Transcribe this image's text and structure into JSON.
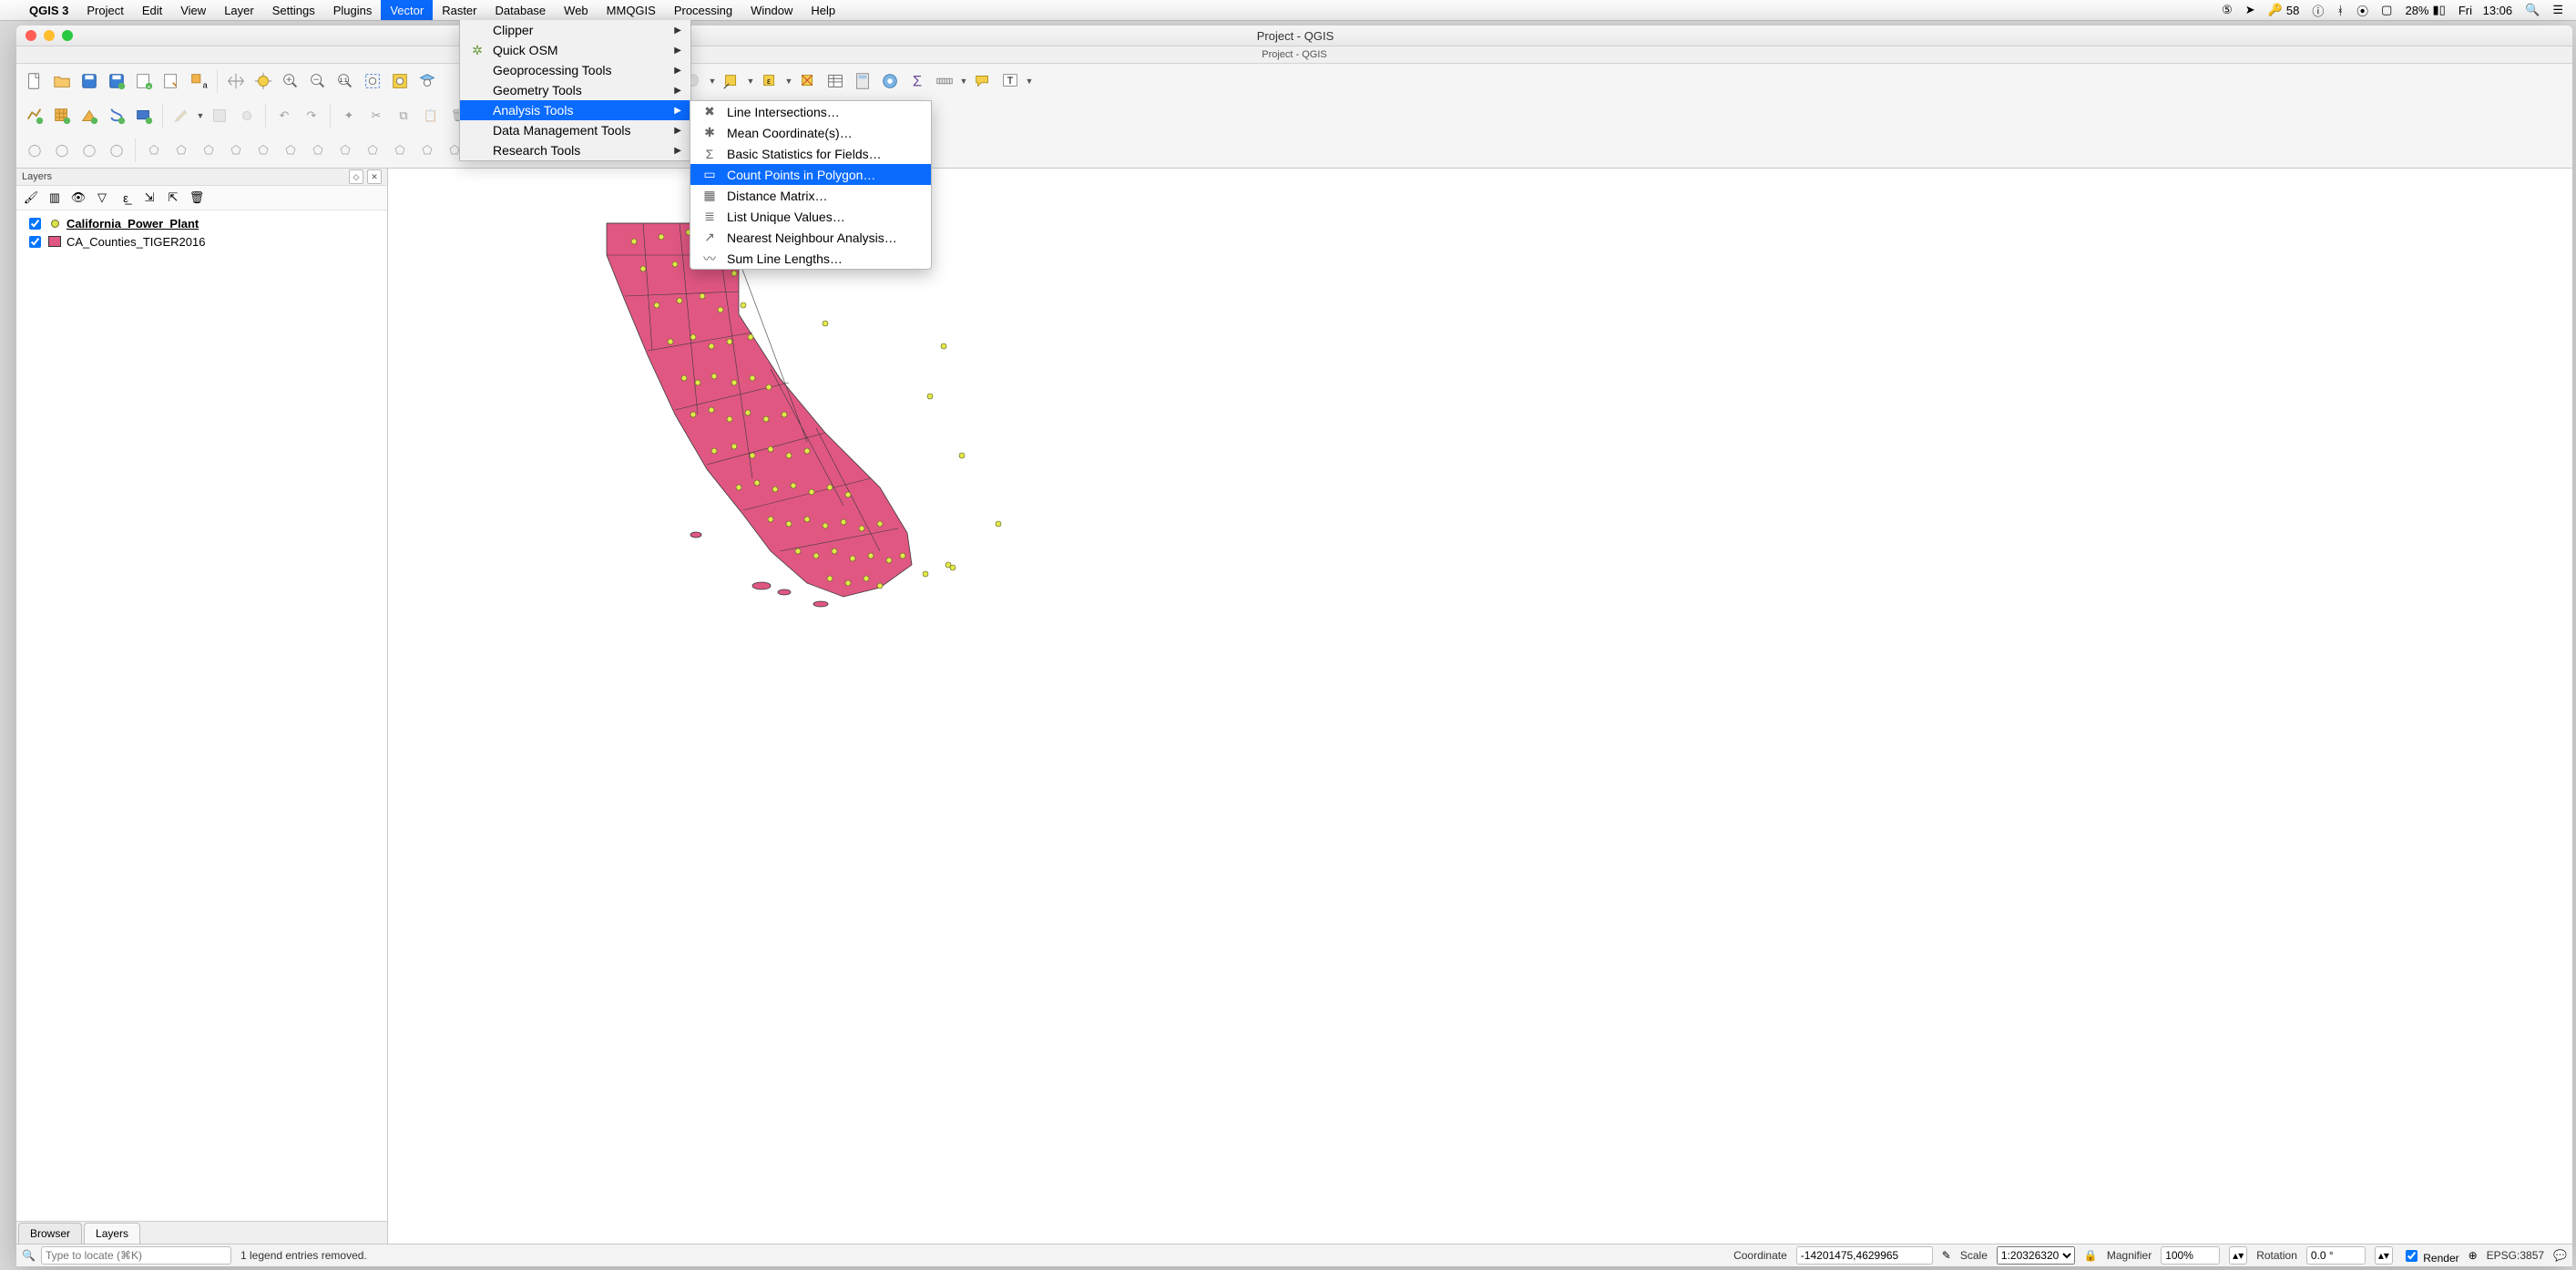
{
  "mac_menu": {
    "app": "QGIS 3",
    "items": [
      "Project",
      "Edit",
      "View",
      "Layer",
      "Settings",
      "Plugins",
      "Vector",
      "Raster",
      "Database",
      "Web",
      "MMQGIS",
      "Processing",
      "Window",
      "Help"
    ],
    "selected": "Vector"
  },
  "mac_status": {
    "shield": "⑤",
    "key_count": "58",
    "battery": "28%",
    "clock_day": "Fri",
    "clock_time": "13:06"
  },
  "window": {
    "title": "Project - QGIS",
    "subtitle": "Project - QGIS"
  },
  "vector_menu": {
    "items": [
      {
        "label": "Clipper",
        "arrow": true,
        "icon": ""
      },
      {
        "label": "Quick OSM",
        "arrow": true,
        "icon": "osm"
      },
      {
        "label": "Geoprocessing Tools",
        "arrow": true,
        "icon": ""
      },
      {
        "label": "Geometry Tools",
        "arrow": true,
        "icon": ""
      },
      {
        "label": "Analysis Tools",
        "arrow": true,
        "icon": "",
        "selected": true
      },
      {
        "label": "Data Management Tools",
        "arrow": true,
        "icon": ""
      },
      {
        "label": "Research Tools",
        "arrow": true,
        "icon": ""
      }
    ]
  },
  "analysis_menu": {
    "items": [
      {
        "label": "Line Intersections…",
        "icon": "✖"
      },
      {
        "label": "Mean Coordinate(s)…",
        "icon": "✱"
      },
      {
        "label": "Basic Statistics for Fields…",
        "icon": "Σ"
      },
      {
        "label": "Count Points in Polygon…",
        "icon": "▭",
        "selected": true
      },
      {
        "label": "Distance Matrix…",
        "icon": "▦"
      },
      {
        "label": "List Unique Values…",
        "icon": "≣"
      },
      {
        "label": "Nearest Neighbour Analysis…",
        "icon": "↗"
      },
      {
        "label": "Sum Line Lengths…",
        "icon": "〰"
      }
    ]
  },
  "layers_panel": {
    "title": "Layers",
    "tabs": [
      "Browser",
      "Layers"
    ],
    "active_tab": "Layers",
    "items": [
      {
        "checked": true,
        "symbol": "point",
        "label": "California_Power_Plant",
        "current": true
      },
      {
        "checked": true,
        "symbol": "poly",
        "label": "CA_Counties_TIGER2016",
        "current": false
      }
    ]
  },
  "statusbar": {
    "locate_placeholder": "Type to locate (⌘K)",
    "message": "1 legend entries removed.",
    "coord_label": "Coordinate",
    "coord_value": "-14201475,4629965",
    "scale_label": "Scale",
    "scale_value": "1:20326320",
    "magnifier_label": "Magnifier",
    "magnifier_value": "100%",
    "rotation_label": "Rotation",
    "rotation_value": "0.0 °",
    "render_label": "Render",
    "crs": "EPSG:3857"
  },
  "colors": {
    "highlight": "#0a6bff",
    "polygon_fill": "#e05782",
    "polygon_stroke": "#3a3a3a",
    "point_fill": "#e3e84a",
    "point_stroke": "#5b5b20"
  },
  "toolbar_icons": {
    "row1": [
      "new",
      "open",
      "save",
      "save-as",
      "new-print",
      "layout-mgr",
      "style-mgr",
      "|",
      "pan",
      "pan-selection",
      "zoom-in",
      "zoom-out",
      "zoom-native",
      "zoom-full",
      "zoom-selection",
      "zoom-layer",
      "zoom-last",
      "zoom-next",
      "|",
      "identify",
      "identify-dd",
      "select",
      "select-dd",
      "select-exp",
      "select-dd2",
      "deselect",
      "attr-table",
      "field-calc",
      "processing-toolbox",
      "stats",
      "measure",
      "measure-dd",
      "map-tips",
      "annotation",
      "annotation-dd"
    ],
    "row2": [
      "add-vector",
      "add-raster",
      "add-mesh",
      "add-delimited",
      "add-wms",
      "|",
      "pencil",
      "pencil-dd",
      "save-edits",
      "add-feature",
      "|",
      "undo",
      "redo",
      "|",
      "node-tool",
      "cut",
      "copy",
      "paste",
      "delete",
      "|",
      "topo1",
      "topo2",
      "topo3",
      "|",
      "prev-inter",
      "prev-clip",
      "|",
      "help"
    ],
    "row3": [
      "digitize1",
      "digitize2",
      "digitize3",
      "digitize4",
      "|",
      "adv1",
      "adv2",
      "adv3",
      "adv4",
      "adv5",
      "adv6",
      "adv7",
      "adv8",
      "adv9",
      "adv10",
      "adv11",
      "adv12"
    ],
    "layer_panel": [
      "style",
      "filter",
      "visibility",
      "filter2",
      "expr",
      "expand",
      "collapse",
      "remove"
    ]
  }
}
